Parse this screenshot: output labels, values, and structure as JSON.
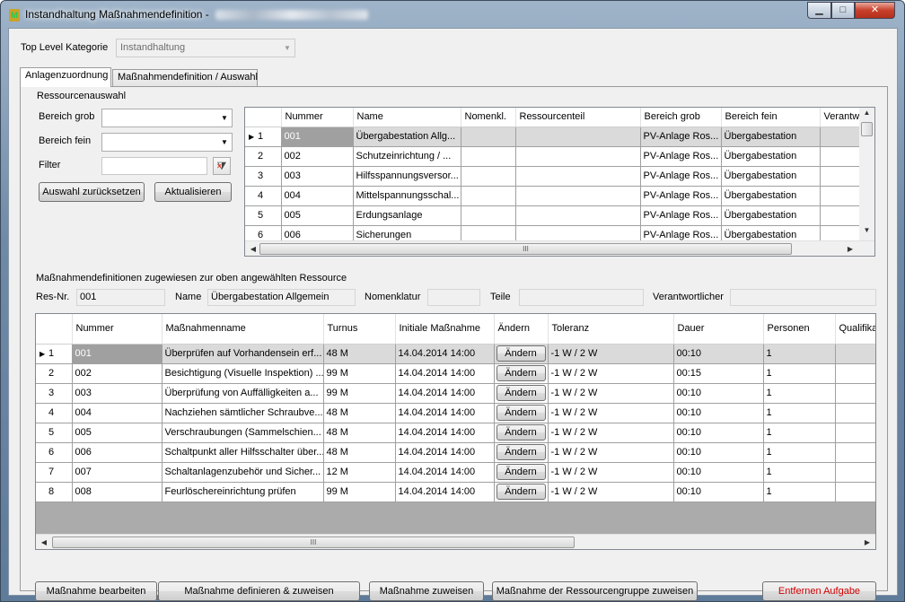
{
  "window": {
    "title": "Instandhaltung Maßnahmendefinition - ",
    "app_icon": "app-icon",
    "min_icon": "▁",
    "max_icon": "□",
    "close_icon": "✕"
  },
  "top": {
    "category_label": "Top Level Kategorie",
    "category_value": "Instandhaltung"
  },
  "tabs": [
    {
      "label": "Anlagenzuordnung"
    },
    {
      "label": "Maßnahmendefinition / Auswahl"
    }
  ],
  "resource_group": {
    "title": "Ressourcenauswahl",
    "bereich_grob_label": "Bereich grob",
    "bereich_fein_label": "Bereich fein",
    "filter_label": "Filter",
    "filter_value": "",
    "reset_button": "Auswahl zurücksetzen",
    "refresh_button": "Aktualisieren"
  },
  "resource_grid": {
    "columns": [
      "Nummer",
      "Name",
      "Nomenkl.",
      "Ressourcenteil",
      "Bereich grob",
      "Bereich fein",
      "Verantwortli"
    ],
    "rows": [
      {
        "idx": "1",
        "cells": [
          "001",
          "Übergabestation Allg...",
          "",
          "",
          "PV-Anlage Ros...",
          "Übergabestation",
          ""
        ]
      },
      {
        "idx": "2",
        "cells": [
          "002",
          "Schutzeinrichtung / ...",
          "",
          "",
          "PV-Anlage Ros...",
          "Übergabestation",
          ""
        ]
      },
      {
        "idx": "3",
        "cells": [
          "003",
          "Hilfsspannungsversor...",
          "",
          "",
          "PV-Anlage Ros...",
          "Übergabestation",
          ""
        ]
      },
      {
        "idx": "4",
        "cells": [
          "004",
          "Mittelspannungsschal...",
          "",
          "",
          "PV-Anlage Ros...",
          "Übergabestation",
          ""
        ]
      },
      {
        "idx": "5",
        "cells": [
          "005",
          "Erdungsanlage",
          "",
          "",
          "PV-Anlage Ros...",
          "Übergabestation",
          ""
        ]
      },
      {
        "idx": "6",
        "cells": [
          "006",
          "Sicherungen",
          "",
          "",
          "PV-Anlage Ros...",
          "Übergabestation",
          ""
        ]
      }
    ],
    "scroll_grip": "III"
  },
  "assigned": {
    "title": "Maßnahmendefinitionen zugewiesen zur oben angewählten Ressource",
    "resnr_label": "Res-Nr.",
    "resnr_value": "001",
    "name_label": "Name",
    "name_value": "Übergabestation Allgemein",
    "nomenklatur_label": "Nomenklatur",
    "nomenklatur_value": "",
    "teile_label": "Teile",
    "teile_value": "",
    "verantwortlicher_label": "Verantwortlicher",
    "verantwortlicher_value": ""
  },
  "measure_grid": {
    "columns": [
      "Nummer",
      "Maßnahmenname",
      "Turnus",
      "Initiale Maßnahme",
      "Ändern",
      "Toleranz",
      "Dauer",
      "Personen",
      "Qualifika"
    ],
    "change_label": "Ändern",
    "rows": [
      {
        "idx": "1",
        "nummer": "001",
        "name": "Überprüfen auf Vorhandensein erf...",
        "turnus": "48 M",
        "initial": "14.04.2014 14:00",
        "toleranz": "-1 W / 2 W",
        "dauer": "00:10",
        "personen": "1"
      },
      {
        "idx": "2",
        "nummer": "002",
        "name": "Besichtigung (Visuelle Inspektion) ...",
        "turnus": "99 M",
        "initial": "14.04.2014 14:00",
        "toleranz": "-1 W / 2 W",
        "dauer": "00:15",
        "personen": "1"
      },
      {
        "idx": "3",
        "nummer": "003",
        "name": "Überprüfung von Auffälligkeiten a...",
        "turnus": "99 M",
        "initial": "14.04.2014 14:00",
        "toleranz": "-1 W / 2 W",
        "dauer": "00:10",
        "personen": "1"
      },
      {
        "idx": "4",
        "nummer": "004",
        "name": "Nachziehen sämtlicher Schraubve...",
        "turnus": "48 M",
        "initial": "14.04.2014 14:00",
        "toleranz": "-1 W / 2 W",
        "dauer": "00:10",
        "personen": "1"
      },
      {
        "idx": "5",
        "nummer": "005",
        "name": "Verschraubungen (Sammelschien...",
        "turnus": "48 M",
        "initial": "14.04.2014 14:00",
        "toleranz": "-1 W / 2 W",
        "dauer": "00:10",
        "personen": "1"
      },
      {
        "idx": "6",
        "nummer": "006",
        "name": "Schaltpunkt aller Hilfsschalter über...",
        "turnus": "48 M",
        "initial": "14.04.2014 14:00",
        "toleranz": "-1 W / 2 W",
        "dauer": "00:10",
        "personen": "1"
      },
      {
        "idx": "7",
        "nummer": "007",
        "name": "Schaltanlagenzubehör und Sicher...",
        "turnus": "12 M",
        "initial": "14.04.2014 14:00",
        "toleranz": "-1 W / 2 W",
        "dauer": "00:10",
        "personen": "1"
      },
      {
        "idx": "8",
        "nummer": "008",
        "name": "Feurlöschereinrichtung prüfen",
        "turnus": "99 M",
        "initial": "14.04.2014 14:00",
        "toleranz": "-1 W / 2 W",
        "dauer": "00:10",
        "personen": "1"
      }
    ],
    "scroll_grip": "III"
  },
  "actions": {
    "edit": "Maßnahme bearbeiten",
    "define_assign": "Maßnahme definieren & zuweisen",
    "assign": "Maßnahme zuweisen",
    "assign_group": "Maßnahme der Ressourcengruppe zuweisen",
    "remove": "Entfernen Aufgabe"
  },
  "colors": {
    "remove_text": "#d00000",
    "selection": "#dadada"
  }
}
